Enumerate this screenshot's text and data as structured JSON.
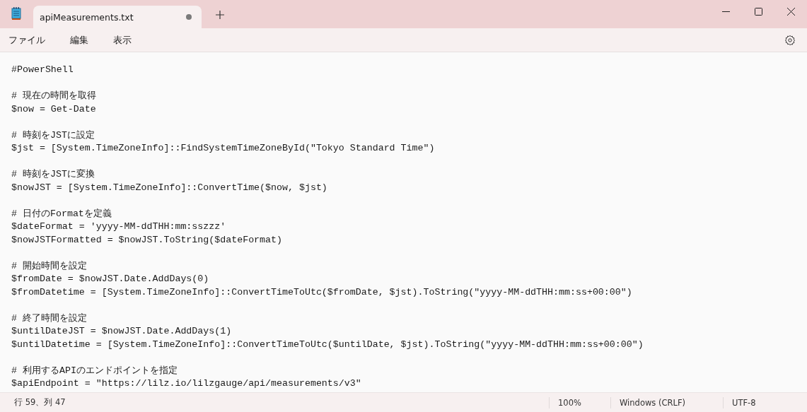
{
  "tab": {
    "title": "apiMeasurements.txt",
    "modified": true,
    "selected": true
  },
  "menu": [
    "ファイル",
    "編集",
    "表示"
  ],
  "editor": {
    "blocks": [
      [
        "#PowerShell"
      ],
      [
        "# 現在の時間を取得",
        "$now = Get-Date"
      ],
      [
        "# 時刻をJSTに設定",
        "$jst = [System.TimeZoneInfo]::FindSystemTimeZoneById(\"Tokyo Standard Time\")"
      ],
      [
        "# 時刻をJSTに変換",
        "$nowJST = [System.TimeZoneInfo]::ConvertTime($now, $jst)"
      ],
      [
        "# 日付のFormatを定義",
        "$dateFormat = 'yyyy-MM-ddTHH:mm:sszzz'",
        "$nowJSTFormatted = $nowJST.ToString($dateFormat)"
      ],
      [
        "# 開始時間を設定",
        "$fromDate = $nowJST.Date.AddDays(0)",
        "$fromDatetime = [System.TimeZoneInfo]::ConvertTimeToUtc($fromDate, $jst).ToString(\"yyyy-MM-ddTHH:mm:ss+00:00\")"
      ],
      [
        "# 終了時間を設定",
        "$untilDateJST = $nowJST.Date.AddDays(1)",
        "$untilDatetime = [System.TimeZoneInfo]::ConvertTimeToUtc($untilDate, $jst).ToString(\"yyyy-MM-ddTHH:mm:ss+00:00\")"
      ],
      [
        "# 利用するAPIのエンドポイントを指定",
        "$apiEndpoint = \"https://lilz.io/lilzgauge/api/measurements/v3\""
      ]
    ]
  },
  "status_bar": {
    "position": "行 59、列 47",
    "zoom": "100%",
    "line_ending": "Windows (CRLF)",
    "encoding": "UTF-8"
  }
}
